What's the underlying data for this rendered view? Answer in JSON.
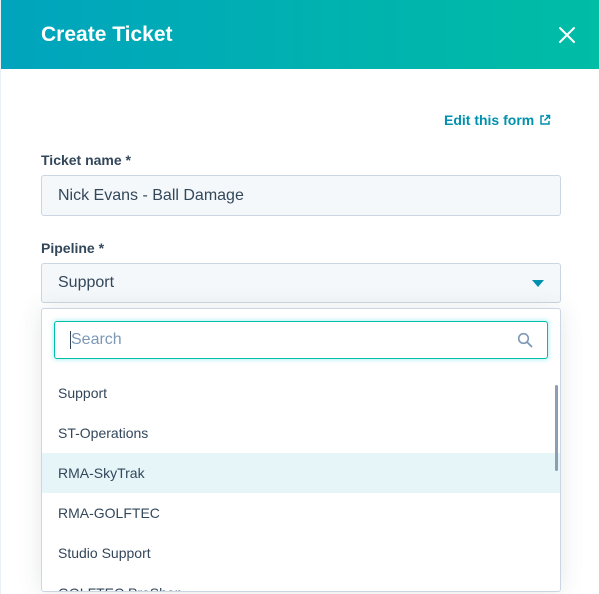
{
  "header": {
    "title": "Create Ticket"
  },
  "form": {
    "edit_link": "Edit this form",
    "ticket_name": {
      "label": "Ticket name *",
      "value": "Nick Evans - Ball Damage"
    },
    "pipeline": {
      "label": "Pipeline *",
      "selected": "Support"
    }
  },
  "dropdown": {
    "search_placeholder": "Search",
    "options": [
      {
        "label": "Support"
      },
      {
        "label": "ST-Operations"
      },
      {
        "label": "RMA-SkyTrak"
      },
      {
        "label": "RMA-GOLFTEC"
      },
      {
        "label": "Studio Support"
      },
      {
        "label": "GOLFTEC ProShop"
      }
    ],
    "hovered_index": 2
  },
  "colors": {
    "header_gradient_start": "#00a4bd",
    "header_gradient_end": "#00bda5",
    "link": "#0091ae",
    "text": "#33475b",
    "hover_bg": "#e5f5f8"
  }
}
